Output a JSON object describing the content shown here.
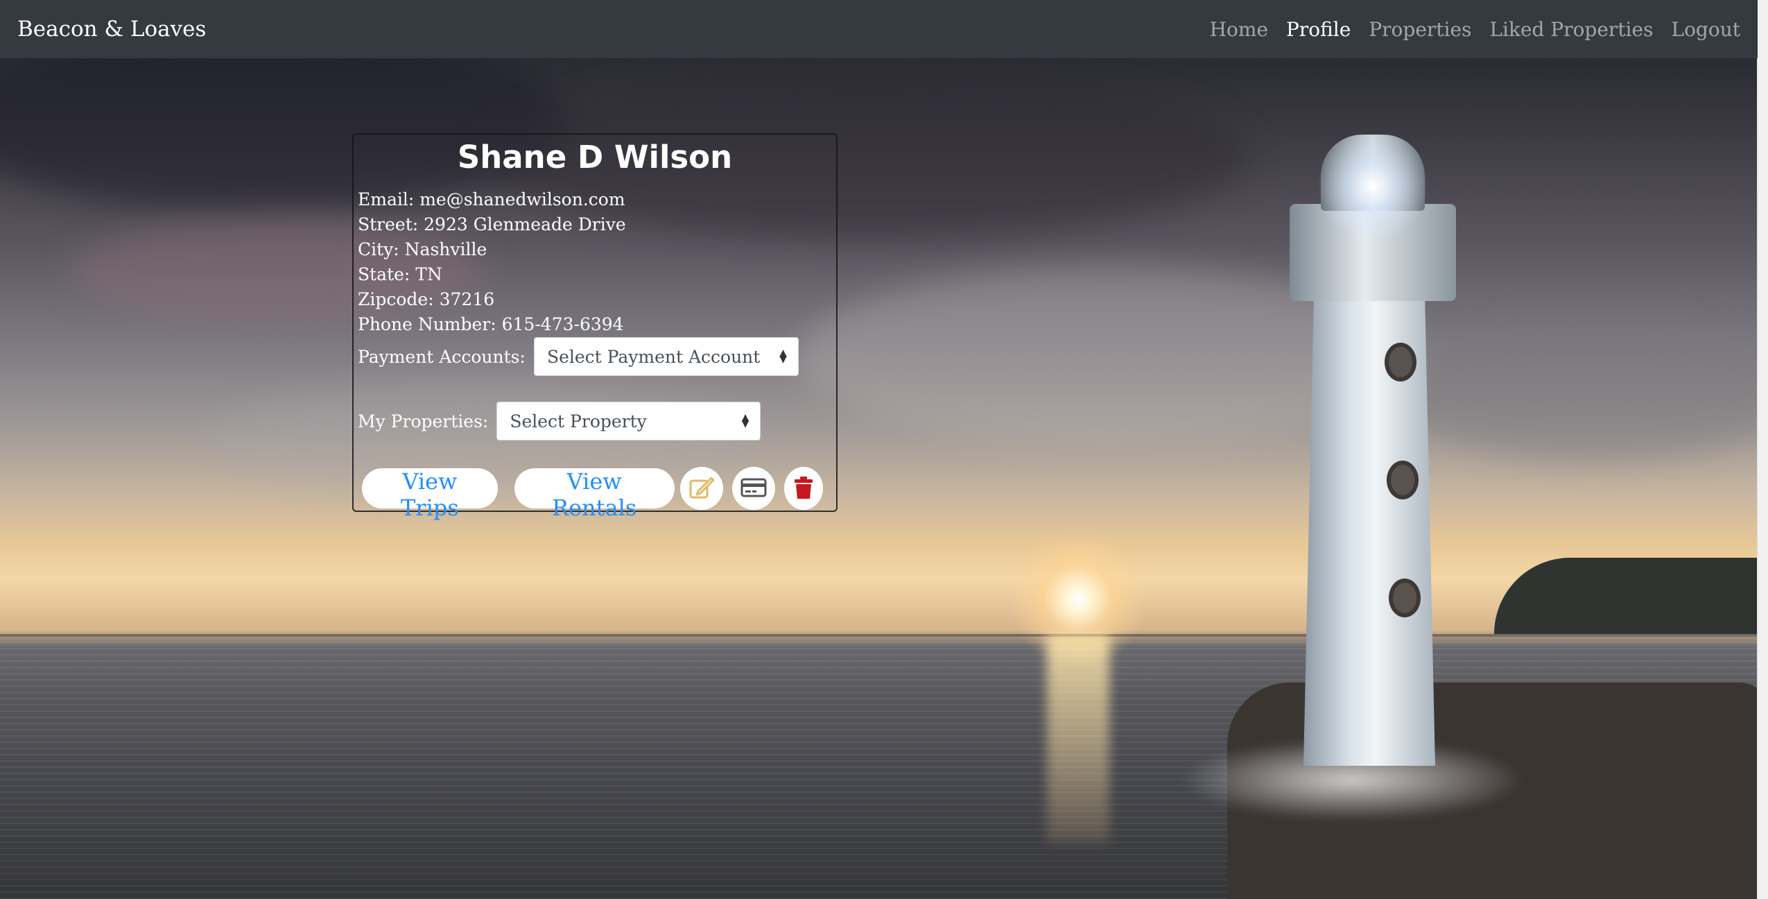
{
  "nav": {
    "brand": "Beacon & Loaves",
    "links": [
      {
        "label": "Home",
        "active": false
      },
      {
        "label": "Profile",
        "active": true
      },
      {
        "label": "Properties",
        "active": false
      },
      {
        "label": "Liked Properties",
        "active": false
      },
      {
        "label": "Logout",
        "active": false
      }
    ]
  },
  "profile": {
    "name": "Shane D Wilson",
    "email": "Email: me@shanedwilson.com",
    "street": "Street: 2923 Glenmeade Drive",
    "city": "City: Nashville",
    "state": "State: TN",
    "zipcode": "Zipcode: 37216",
    "phone": "Phone Number: 615-473-6394",
    "payment_label": "Payment Accounts:",
    "payment_select": "Select Payment Account",
    "properties_label": "My Properties:",
    "properties_select": "Select Property"
  },
  "actions": {
    "view_trips": "View Trips",
    "view_rentals": "View Rentals",
    "edit_icon": "edit-icon",
    "payment_icon": "credit-card-icon",
    "delete_icon": "trash-icon"
  },
  "colors": {
    "navbar_bg": "#343a40",
    "link_blue": "#1e8fff",
    "edit_gold": "#e0b96a",
    "delete_red": "#c8171e"
  }
}
